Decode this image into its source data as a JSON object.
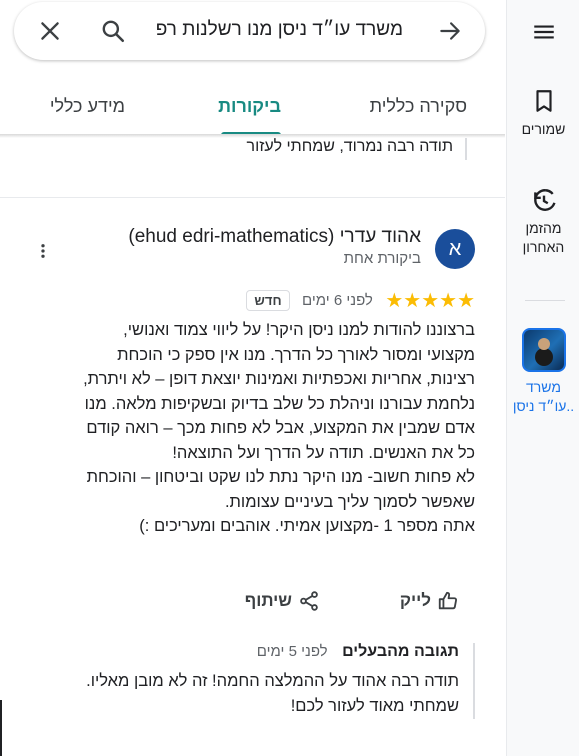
{
  "search": {
    "query": "משרד עו״ד ניסן מנו רשלנות רפ"
  },
  "tabs": [
    {
      "label": "סקירה כללית"
    },
    {
      "label": "ביקורות"
    },
    {
      "label": "מידע כללי"
    }
  ],
  "active_tab": "ביקורות",
  "previous_review": {
    "last_line": "תודה רבה נמרוד, שמחתי לעזור"
  },
  "review": {
    "avatar_letter": "א",
    "author": "אהוד עדרי (ehud edri-mathematics)",
    "meta": "ביקורת אחת",
    "stars": "★★★★★",
    "rating": 5,
    "time": "לפני 6 ימים",
    "badge": "חדש",
    "lines": [
      "ברצוננו להודות למנו ניסן היקר! על ליווי צמוד ואנושי,",
      "מקצועי ומסור לאורך כל הדרך. מנו אין ספק כי הוכחת",
      "רצינות, אחריות ואכפתיות ואמינות יוצאת דופן – לא ויתרת,",
      "נלחמת עבורנו וניהלת כל שלב בדיוק ובשקיפות מלאה. מנו",
      "אדם שמבין את המקצוע, אבל לא פחות מכך – רואה קודם",
      "כל את האנשים. תודה על הדרך ועל התוצאה!",
      "לא פחות חשוב- מנו היקר נתת לנו שקט וביטחון – והוכחת",
      "שאפשר לסמוך עליך בעיניים עצומות.",
      "אתה מספר 1 -מקצוען אמיתי. אוהבים ומעריכים :)"
    ],
    "like_label": "לייק",
    "share_label": "שיתוף"
  },
  "owner_reply": {
    "title": "תגובה מהבעלים",
    "time": "לפני 5 ימים",
    "lines": [
      "תודה רבה אהוד על ההמלצה החמה! זה לא מובן מאליו.",
      "שמחתי מאוד לעזור לכם!"
    ]
  },
  "rail": {
    "saved": "שמורים",
    "recent": [
      "מהזמן",
      "האחרון"
    ],
    "place": [
      "משרד",
      "עו״ד ניסן.."
    ]
  },
  "icons": [
    "menu-icon",
    "bookmark-icon",
    "history-icon",
    "back-arrow-icon",
    "search-icon",
    "close-icon",
    "more-vert-icon",
    "thumb-up-icon",
    "share-icon"
  ],
  "colors": {
    "accent": "#188a82",
    "star": "#fbbc04",
    "avatar": "#1a4e9b",
    "link": "#1a73e8"
  }
}
